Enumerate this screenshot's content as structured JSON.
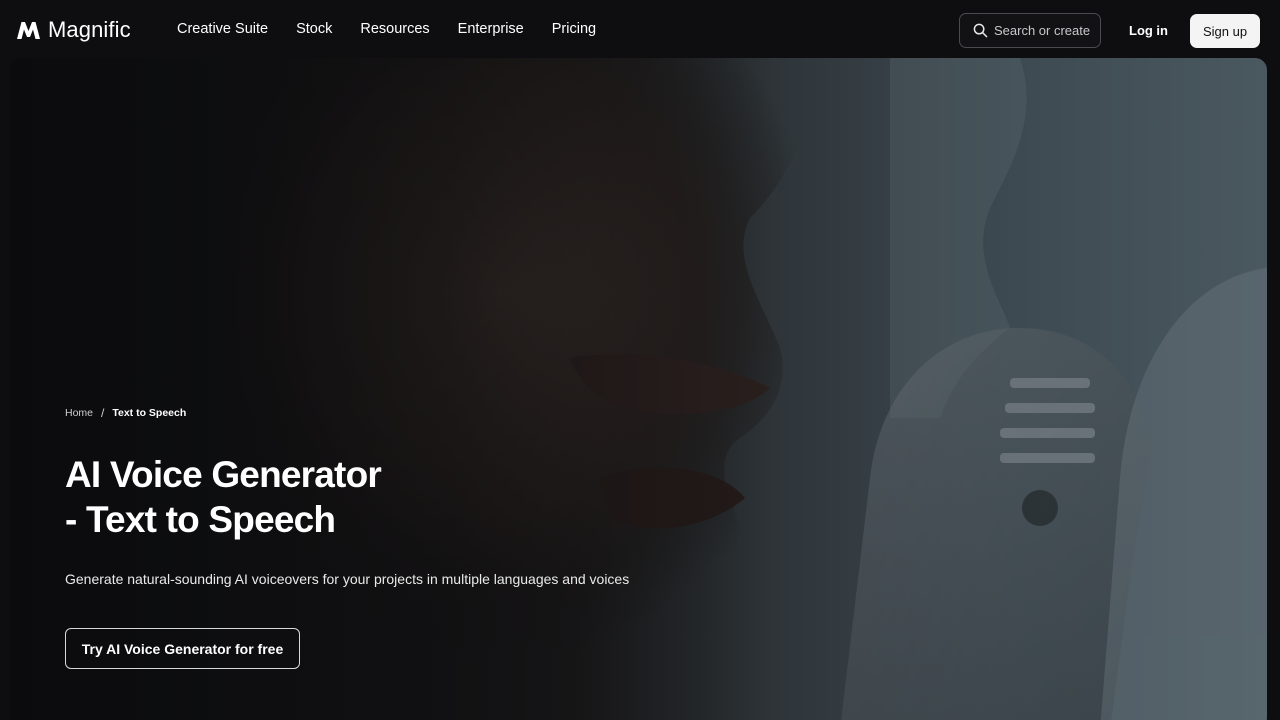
{
  "nav": {
    "brand": "Magnific",
    "menu": [
      {
        "label": "Creative Suite"
      },
      {
        "label": "Stock"
      },
      {
        "label": "Resources"
      },
      {
        "label": "Enterprise"
      },
      {
        "label": "Pricing"
      }
    ],
    "search_placeholder": "Search or create",
    "login_label": "Log in",
    "signup_label": "Sign up"
  },
  "hero": {
    "breadcrumb": {
      "home": "Home",
      "separator": "/",
      "current": "Text to Speech"
    },
    "title_line1": "AI Voice Generator",
    "title_line2": "- Text to Speech",
    "subtitle": "Generate natural-sounding AI voiceovers for your projects in multiple languages and voices",
    "cta_label": "Try AI Voice Generator for free"
  },
  "colors": {
    "background": "#0e0e10",
    "text": "#ffffff",
    "signup_bg": "#f4f4f4",
    "signup_text": "#111111"
  },
  "icons": {
    "logo": "magnific-logo-icon",
    "search": "search-icon"
  }
}
